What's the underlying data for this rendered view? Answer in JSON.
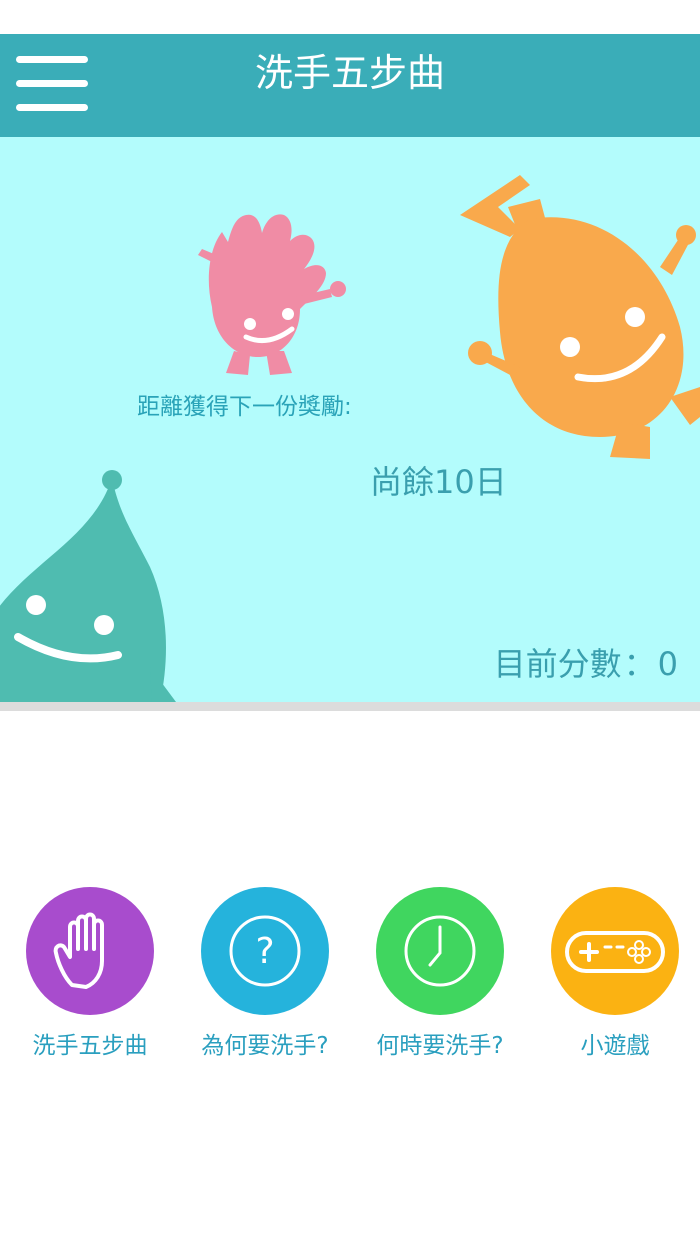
{
  "header": {
    "title": "洗手五步曲"
  },
  "hero": {
    "reward_label": "距離獲得下一份獎勵:",
    "days_left": "尚餘10日",
    "score_label": "目前分數",
    "score_sep": "：",
    "score_value": "0"
  },
  "menu": [
    {
      "label": "洗手五步曲",
      "icon": "hand-icon",
      "color": "#a84ccd"
    },
    {
      "label": "為何要洗手?",
      "icon": "question-icon",
      "color": "#25b3dc"
    },
    {
      "label": "何時要洗手?",
      "icon": "clock-icon",
      "color": "#40d65f"
    },
    {
      "label": "小遊戲",
      "icon": "gamepad-icon",
      "color": "#fbb212"
    }
  ],
  "colors": {
    "nav": "#3aadb8",
    "hero_bg": "#b3fcfc",
    "text_accent": "#2aa3b8"
  }
}
